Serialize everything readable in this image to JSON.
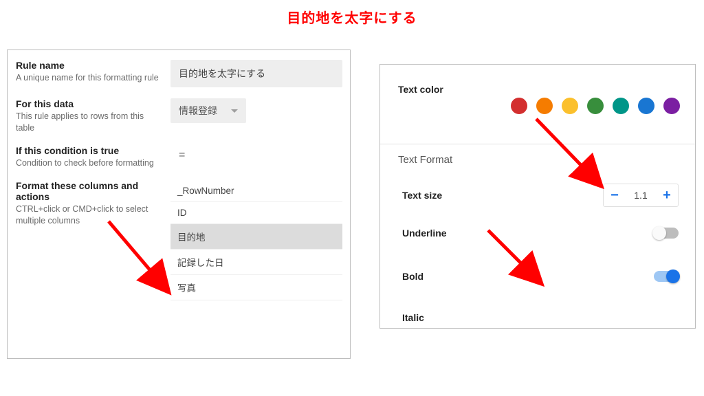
{
  "page_title": "目的地を太字にする",
  "left": {
    "ruleName": {
      "title": "Rule name",
      "sub": "A unique name for this formatting rule",
      "value": "目的地を太字にする"
    },
    "forData": {
      "title": "For this data",
      "sub": "This rule applies to rows from this table",
      "value": "情報登録"
    },
    "condition": {
      "title": "If this condition is true",
      "sub": "Condition to check before formatting",
      "value": "="
    },
    "formatCols": {
      "title": "Format these columns and actions",
      "sub": "CTRL+click or CMD+click to select multiple columns"
    },
    "columns": [
      "_RowNumber",
      "ID",
      "目的地",
      "記録した日",
      "写真"
    ],
    "selectedIndex": 2
  },
  "right": {
    "textColorLabel": "Text color",
    "swatches": [
      "#d32f2f",
      "#f57c00",
      "#fbc02d",
      "#388e3c",
      "#009688",
      "#1976d2",
      "#7b1fa2"
    ],
    "textFormatHeader": "Text Format",
    "textSize": {
      "label": "Text size",
      "value": "1.1"
    },
    "underline": {
      "label": "Underline",
      "on": false
    },
    "bold": {
      "label": "Bold",
      "on": true
    },
    "italic": {
      "label": "Italic"
    }
  }
}
